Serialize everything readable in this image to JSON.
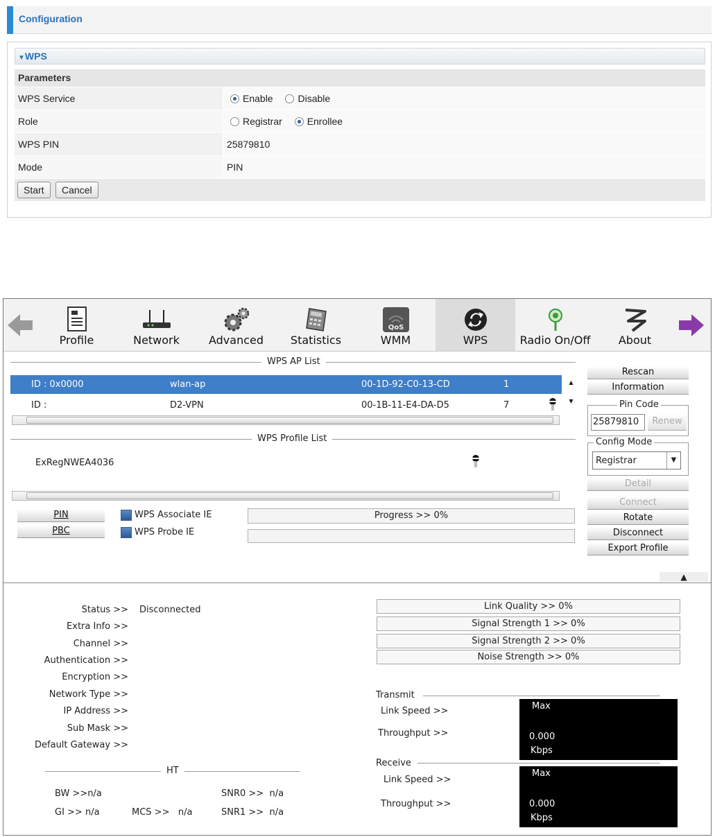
{
  "config": {
    "header_title": "Configuration",
    "section_title": "WPS",
    "params_label": "Parameters",
    "rows": {
      "wps_service": {
        "label": "WPS Service",
        "options": [
          "Enable",
          "Disable"
        ],
        "selected": "Enable"
      },
      "role": {
        "label": "Role",
        "options": [
          "Registrar",
          "Enrollee"
        ],
        "selected": "Enrollee"
      },
      "wps_pin": {
        "label": "WPS PIN",
        "value": "25879810"
      },
      "mode": {
        "label": "Mode",
        "value": "PIN"
      }
    },
    "buttons": {
      "start": "Start",
      "cancel": "Cancel"
    }
  },
  "utility": {
    "toolbar": [
      {
        "id": "profile",
        "label": "Profile",
        "icon": "document-icon"
      },
      {
        "id": "network",
        "label": "Network",
        "icon": "router-icon"
      },
      {
        "id": "advanced",
        "label": "Advanced",
        "icon": "gears-icon"
      },
      {
        "id": "statistics",
        "label": "Statistics",
        "icon": "calculator-icon"
      },
      {
        "id": "wmm",
        "label": "WMM",
        "icon": "qos-icon",
        "badge": "QoS"
      },
      {
        "id": "wps",
        "label": "WPS",
        "icon": "wps-icon",
        "active": true
      },
      {
        "id": "radio",
        "label": "Radio On/Off",
        "icon": "antenna-icon"
      },
      {
        "id": "about",
        "label": "About",
        "icon": "about-icon"
      }
    ],
    "ap_list": {
      "caption": "WPS AP List",
      "rows": [
        {
          "id": "ID : 0x0000",
          "ssid": "wlan-ap",
          "bssid": "00-1D-92-C0-13-CD",
          "channel": "1",
          "selected": true
        },
        {
          "id": "ID :",
          "ssid": "D2-VPN",
          "bssid": "00-1B-11-E4-DA-D5",
          "channel": "7",
          "selected": false
        }
      ]
    },
    "side_buttons": {
      "rescan": "Rescan",
      "information": "Information",
      "pin_code_caption": "Pin Code",
      "pin_code_value": "25879810",
      "renew": "Renew",
      "config_mode_caption": "Config Mode",
      "config_mode_value": "Registrar",
      "detail": "Detail",
      "connect": "Connect",
      "rotate": "Rotate",
      "disconnect": "Disconnect",
      "export_profile": "Export Profile"
    },
    "profile_list": {
      "caption": "WPS Profile List",
      "rows": [
        "ExRegNWEA4036"
      ]
    },
    "pin_button": "PIN",
    "pbc_button": "PBC",
    "associate_ie": "WPS Associate IE",
    "probe_ie": "WPS Probe IE",
    "progress_text": "Progress >> 0%",
    "progress": 0,
    "status": {
      "status_label": "Status >>",
      "status_value": "Disconnected",
      "extra_info": "Extra Info >>",
      "channel": "Channel >>",
      "authentication": "Authentication >>",
      "encryption": "Encryption >>",
      "network_type": "Network Type >>",
      "ip_address": "IP Address >>",
      "sub_mask": "Sub Mask >>",
      "default_gateway": "Default Gateway >>"
    },
    "meters": {
      "link_quality": "Link Quality >> 0%",
      "signal1": "Signal Strength 1 >> 0%",
      "signal2": "Signal Strength 2 >> 0%",
      "noise": "Noise Strength >> 0%"
    },
    "ht": {
      "caption": "HT",
      "bw": "BW >>n/a",
      "gi": "GI >> n/a",
      "mcs": "MCS >>   n/a",
      "snr0": "SNR0 >>  n/a",
      "snr1": "SNR1 >>  n/a"
    },
    "transmit": {
      "caption": "Transmit",
      "link_speed": "Link Speed >>",
      "throughput": "Throughput >>",
      "max": "Max",
      "value": "0.000",
      "unit": "Kbps"
    },
    "receive": {
      "caption": "Receive",
      "link_speed": "Link Speed >>",
      "throughput": "Throughput >>",
      "max": "Max",
      "value": "0.000",
      "unit": "Kbps"
    }
  }
}
